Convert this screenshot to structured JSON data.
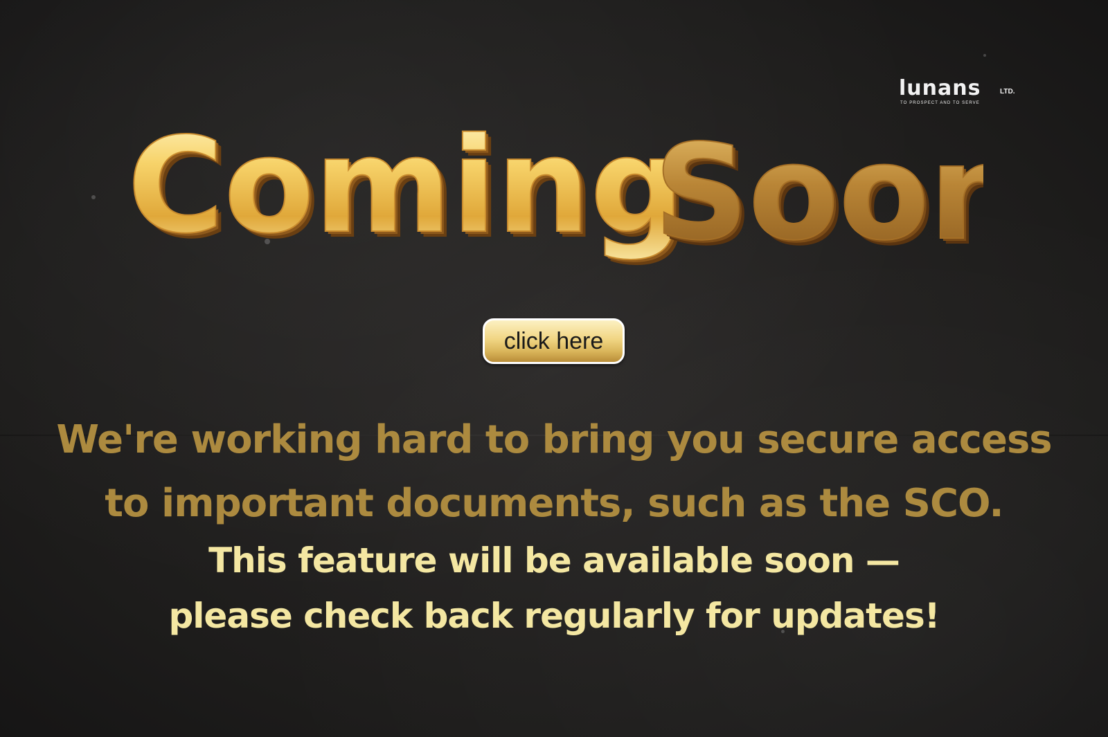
{
  "logo": {
    "name": "lunans",
    "suffix": "LTD.",
    "tagline": "TO PROSPECT AND TO SERVE"
  },
  "headline": {
    "word1": "Coming",
    "word2": "Soon"
  },
  "button": {
    "label": "click here"
  },
  "message": {
    "line1": "We're working hard to bring you secure access",
    "line2": "to important documents, such as the SCO.",
    "line3": "This feature will be available soon —",
    "line4": "please check back regularly for updates!"
  },
  "colors": {
    "background": "#1f1f1f",
    "gold_text": "#ac8a3f",
    "light_text": "#f4e7a2",
    "button_top": "#fcf1c2",
    "button_bottom": "#b98d38",
    "logo": "#f2f2f2"
  }
}
